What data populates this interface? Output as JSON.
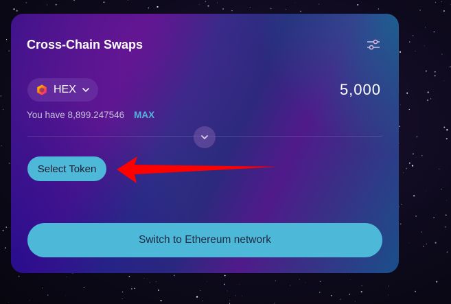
{
  "swap_card": {
    "title": "Cross-Chain Swaps",
    "settings_icon": "sliders-icon",
    "from_token": {
      "symbol": "HEX",
      "icon": "hex-logo-icon",
      "amount": "5,000",
      "balance_label": "You have 8,899.247546",
      "max_label": "MAX"
    },
    "direction_icon": "chevron-down-icon",
    "to_token": {
      "select_label": "Select Token"
    },
    "action_button_label": "Switch to Ethereum network"
  },
  "annotation": {
    "icon": "arrow-left-icon",
    "color": "#ff0000"
  },
  "colors": {
    "accent": "#4db8d8",
    "max_link": "#56b3dd",
    "annotation_arrow": "#ff0000"
  }
}
